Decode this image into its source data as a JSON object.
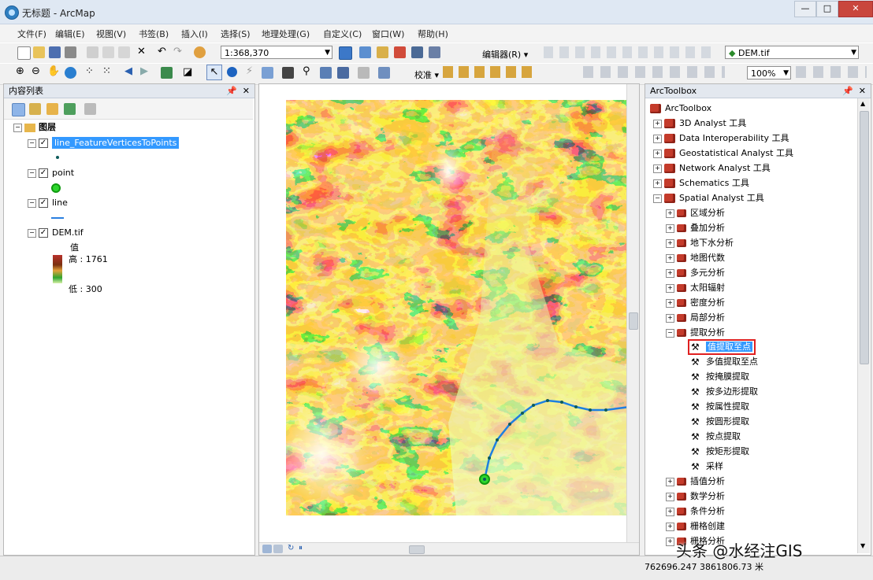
{
  "window": {
    "title": "无标题 - ArcMap"
  },
  "menu": [
    "文件(F)",
    "编辑(E)",
    "视图(V)",
    "书签(B)",
    "插入(I)",
    "选择(S)",
    "地理处理(G)",
    "自定义(C)",
    "窗口(W)",
    "帮助(H)"
  ],
  "toolbar": {
    "scale": "1:368,370",
    "editor_label": "编辑器(R) ▾",
    "layer_combo": "DEM.tif",
    "zoom_percent": "100%",
    "georef_label": "校准 ▾"
  },
  "toc": {
    "title": "内容列表",
    "root_label": "图层",
    "layers": [
      {
        "name": "line_FeatureVerticesToPoints",
        "selected": true
      },
      {
        "name": "point"
      },
      {
        "name": "line"
      },
      {
        "name": "DEM.tif"
      }
    ],
    "legend": {
      "value_label": "值",
      "high": "高 : 1761",
      "low": "低 : 300"
    }
  },
  "toolbox": {
    "title": "ArcToolbox",
    "root": "ArcToolbox",
    "top_items": [
      "3D Analyst 工具",
      "Data Interoperability 工具",
      "Geostatistical Analyst 工具",
      "Network Analyst 工具",
      "Schematics 工具",
      "Spatial Analyst 工具"
    ],
    "spatial_items": [
      "区域分析",
      "叠加分析",
      "地下水分析",
      "地图代数",
      "多元分析",
      "太阳辐射",
      "密度分析",
      "局部分析",
      "提取分析"
    ],
    "extract_tools": [
      "值提取至点",
      "多值提取至点",
      "按掩膜提取",
      "按多边形提取",
      "按属性提取",
      "按圆形提取",
      "按点提取",
      "按矩形提取",
      "采样"
    ],
    "after_items": [
      "插值分析",
      "数学分析",
      "条件分析",
      "栅格创建"
    ],
    "partial_item": "栅格分析"
  },
  "status": {
    "coordinates": "762696.247  3861806.73 米"
  },
  "watermark": "头条 @水经注GIS",
  "colors": {
    "title_bg": "#dfe8f3",
    "selection": "#3399ff",
    "highlight_box": "#e02020",
    "toolbox_red": "#c43b2b",
    "river": "#1e7fe0"
  }
}
